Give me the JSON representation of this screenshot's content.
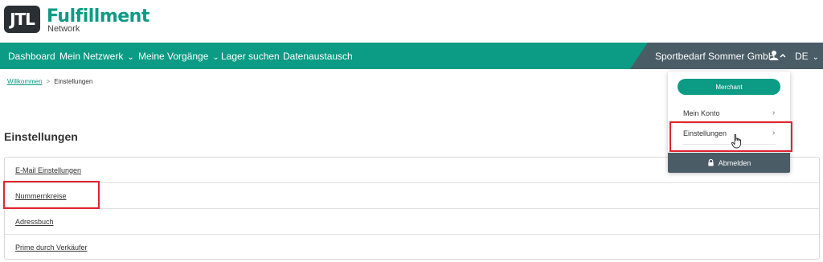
{
  "logo": {
    "mark": "JTL",
    "title": "Fulfillment",
    "subtitle": "Network"
  },
  "nav": {
    "items": [
      "Dashboard",
      "Mein Netzwerk",
      "Meine Vorgänge",
      "Lager suchen",
      "Datenaustausch"
    ],
    "company": "Sportbedarf Sommer GmbH",
    "language": "DE"
  },
  "breadcrumb": {
    "home": "Willkommen",
    "current": "Einstellungen"
  },
  "page": {
    "title": "Einstellungen"
  },
  "settings": {
    "items": [
      "E-Mail Einstellungen",
      "Nummernkreise",
      "Adressbuch",
      "Prime durch Verkäufer"
    ]
  },
  "user_menu": {
    "role": "Merchant",
    "items": [
      "Mein Konto",
      "Einstellungen"
    ],
    "logout": "Abmelden"
  },
  "colors": {
    "brand": "#0c9b84",
    "dark": "#4a5c66",
    "highlight": "#e0242f"
  }
}
